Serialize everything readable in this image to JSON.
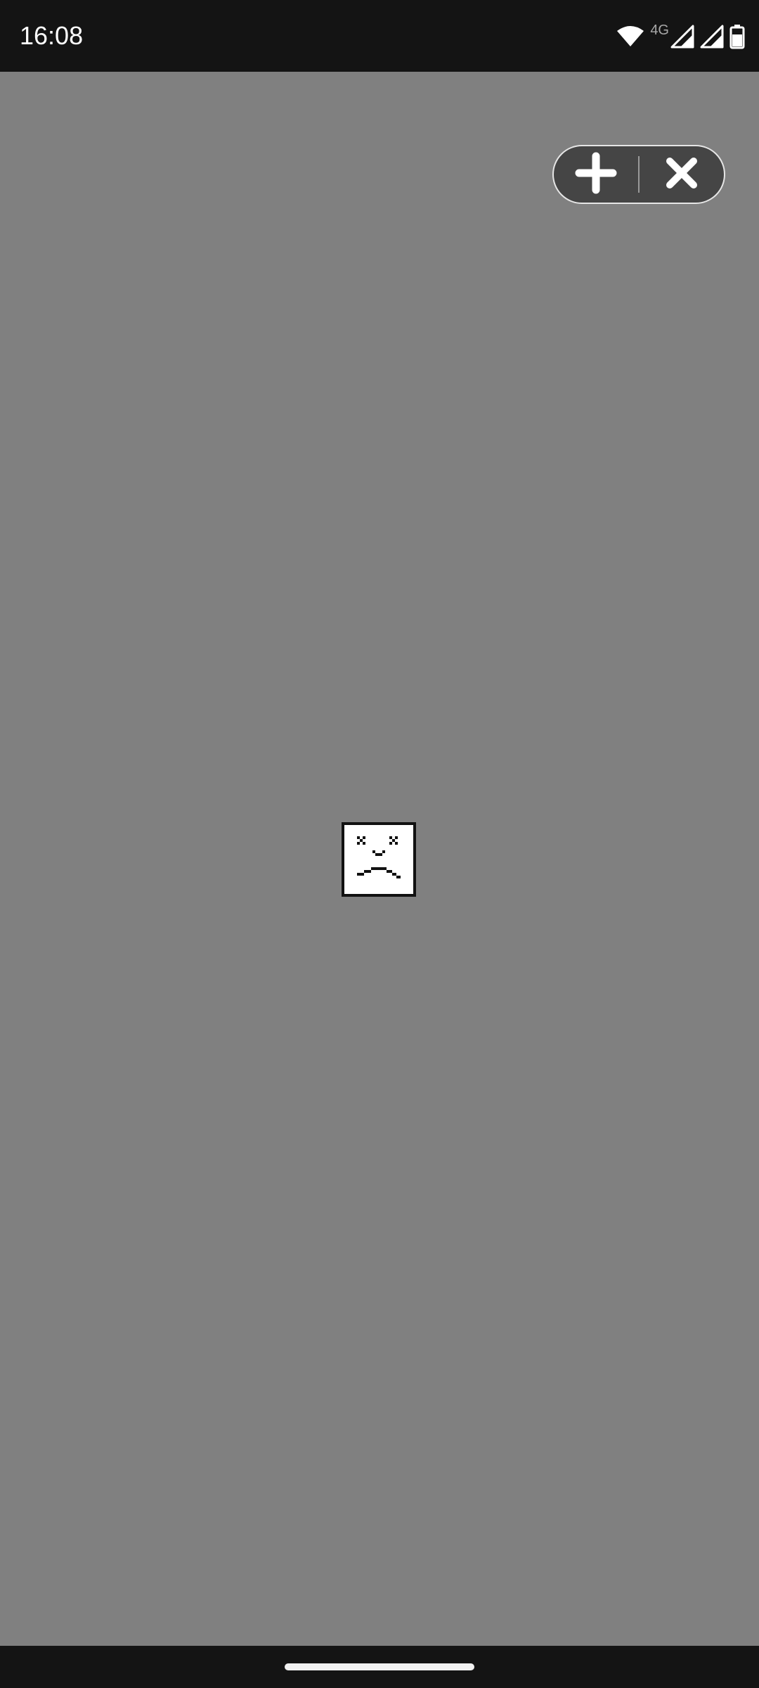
{
  "status_bar": {
    "time": "16:08",
    "network_label": "4G",
    "icons": [
      "wifi-icon",
      "signal-icon",
      "signal-icon",
      "battery-icon"
    ]
  },
  "floating_controls": {
    "buttons": [
      "plus-icon",
      "close-icon"
    ]
  },
  "content": {
    "placeholder": "broken-image-icon"
  },
  "colors": {
    "background": "#808080",
    "bars": "#141414",
    "pill": "#454545"
  }
}
